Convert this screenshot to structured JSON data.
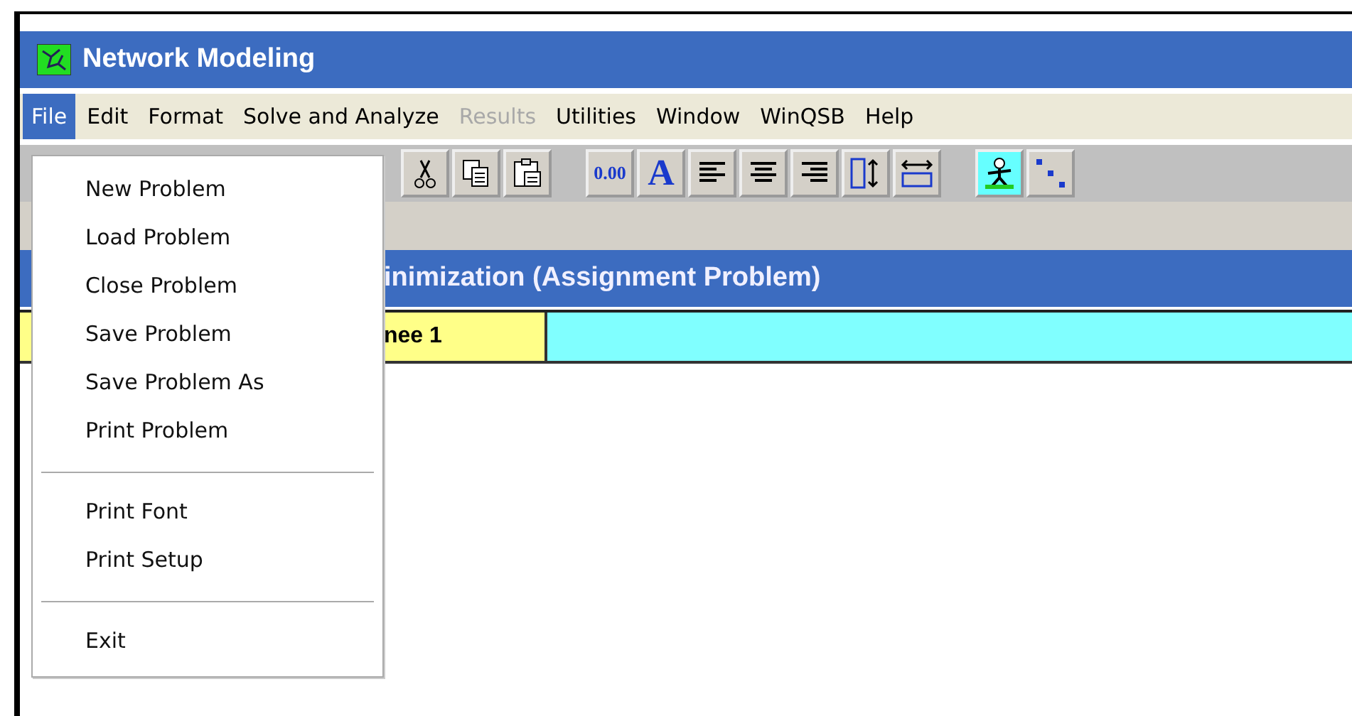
{
  "window": {
    "title": "Network Modeling"
  },
  "menu_bar": [
    {
      "label": "File",
      "selected": true,
      "disabled": false
    },
    {
      "label": "Edit",
      "selected": false,
      "disabled": false
    },
    {
      "label": "Format",
      "selected": false,
      "disabled": false
    },
    {
      "label": "Solve and Analyze",
      "selected": false,
      "disabled": false
    },
    {
      "label": "Results",
      "selected": false,
      "disabled": true
    },
    {
      "label": "Utilities",
      "selected": false,
      "disabled": false
    },
    {
      "label": "Window",
      "selected": false,
      "disabled": false
    },
    {
      "label": "WinQSB",
      "selected": false,
      "disabled": false
    },
    {
      "label": "Help",
      "selected": false,
      "disabled": false
    }
  ],
  "toolbar_groups": [
    [
      {
        "kind": "cut"
      },
      {
        "kind": "copy"
      },
      {
        "kind": "paste"
      }
    ],
    [
      {
        "kind": "number_format",
        "label": "0.00"
      },
      {
        "kind": "font",
        "label": "A"
      },
      {
        "kind": "align_left"
      },
      {
        "kind": "align_center"
      },
      {
        "kind": "align_right"
      },
      {
        "kind": "row_height"
      },
      {
        "kind": "column_width"
      }
    ],
    [
      {
        "kind": "solver"
      },
      {
        "kind": "graph"
      }
    ]
  ],
  "document": {
    "title": "inimization (Assignment Problem)",
    "cells": [
      {
        "text": "nee 1",
        "kind": "header"
      },
      {
        "text": null,
        "kind": "entry"
      }
    ]
  },
  "file_menu": [
    {
      "kind": "item",
      "label": "New Problem"
    },
    {
      "kind": "item",
      "label": "Load Problem"
    },
    {
      "kind": "item",
      "label": "Close Problem"
    },
    {
      "kind": "item",
      "label": "Save Problem"
    },
    {
      "kind": "item",
      "label": "Save Problem As"
    },
    {
      "kind": "item",
      "label": "Print Problem"
    },
    {
      "kind": "separator"
    },
    {
      "kind": "item",
      "label": "Print Font"
    },
    {
      "kind": "item",
      "label": "Print Setup"
    },
    {
      "kind": "separator"
    },
    {
      "kind": "item",
      "label": "Exit"
    }
  ]
}
